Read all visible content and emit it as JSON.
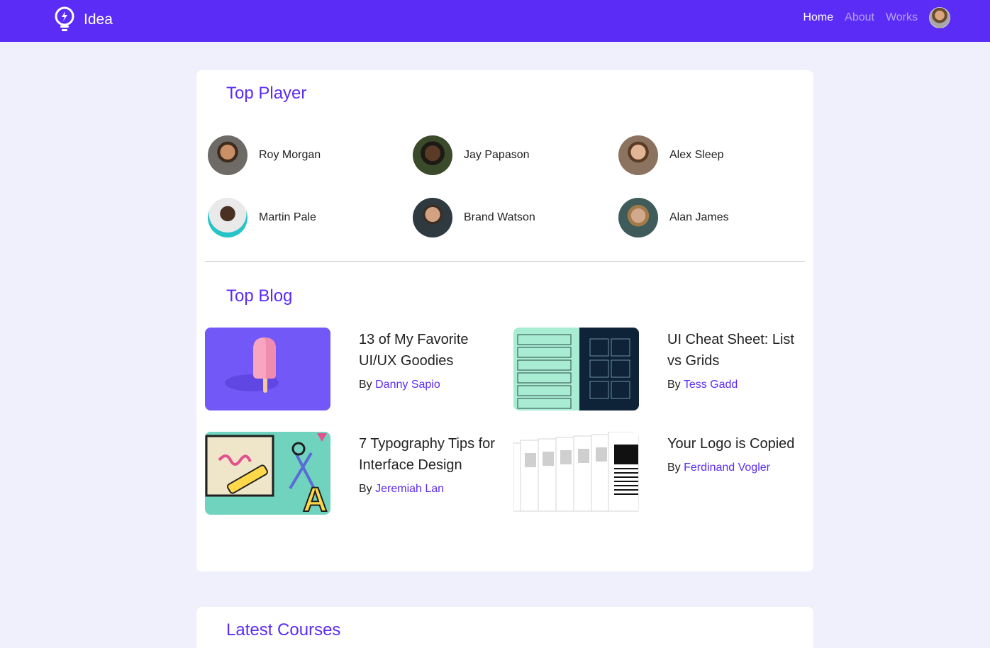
{
  "header": {
    "brand": "Idea",
    "nav": [
      {
        "label": "Home",
        "active": true
      },
      {
        "label": "About",
        "active": false
      },
      {
        "label": "Works",
        "active": false
      }
    ],
    "accent_color": "#5b2cf6"
  },
  "top_player": {
    "title": "Top Player",
    "players": [
      {
        "name": "Roy Morgan"
      },
      {
        "name": "Jay Papason"
      },
      {
        "name": "Alex Sleep"
      },
      {
        "name": "Martin Pale"
      },
      {
        "name": "Brand Watson"
      },
      {
        "name": "Alan James"
      }
    ]
  },
  "top_blog": {
    "title": "Top Blog",
    "posts": [
      {
        "title": "13 of My Favorite UI/UX Goodies",
        "by": "By",
        "author": "Danny Sapio"
      },
      {
        "title": "UI Cheat Sheet: List vs Grids",
        "by": "By",
        "author": "Tess Gadd"
      },
      {
        "title": "7 Typography Tips for Interface Design",
        "by": "By",
        "author": "Jeremiah Lan"
      },
      {
        "title": "Your Logo is Copied",
        "by": "By",
        "author": "Ferdinand Vogler"
      }
    ]
  },
  "latest_courses": {
    "title": "Latest Courses"
  }
}
